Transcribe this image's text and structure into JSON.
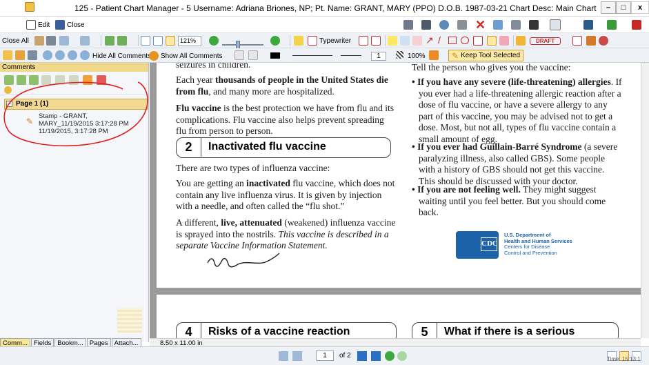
{
  "window": {
    "title": "125 - Patient Chart Manager - 5 Username: Adriana Briones, NP; Pt. Name: GRANT, MARY (PPO) D.O.B. 1987-03-21 Chart Desc: Main Chart",
    "minimize_label": "–",
    "restore_label": "□",
    "close_label": "x"
  },
  "toolbar1": {
    "edit_label": "Edit",
    "close_label": "Close"
  },
  "toolbar2": {
    "close_all_label": "Close All",
    "zoom_value": "121%",
    "typewriter_label": "Typewriter",
    "draft_stamp": "DRAFT"
  },
  "toolbar3": {
    "hide_all_label": "Hide All Comments",
    "show_all_label": "Show All Comments",
    "line_width": "1",
    "opacity": "100%",
    "keep_tool_label": "Keep Tool Selected"
  },
  "comments_panel": {
    "header": "Comments",
    "group_label": "Page 1 (1)",
    "expand_symbol": "−",
    "entry_lines": [
      "Stamp - GRANT,",
      "MARY_11/19/2015 3:17:28 PM",
      "11/19/2015, 3:17:28 PM"
    ]
  },
  "panel_tabs": [
    "Comm...",
    "Fields",
    "Bookm...",
    "Pages",
    "Attach..."
  ],
  "page_size": "8.50 x 11.00 in",
  "document": {
    "left": {
      "p0": "seizures in children.",
      "p1_a": "Each year ",
      "p1_b": "thousands of people in the United States die from flu",
      "p1_c": ", and many more are hospitalized.",
      "p2_a": "Flu vaccine",
      "p2_b": " is the best protection we have from flu and its complications. Flu vaccine also helps prevent spreading flu from person to person.",
      "section_num": "2",
      "section_title": "Inactivated flu vaccine",
      "p3": "There are two types of influenza vaccine:",
      "p4_a": "You are getting an ",
      "p4_b": "inactivated",
      "p4_c": " flu vaccine, which does not contain any live influenza virus. It is given by injection with a needle, and often called the “flu shot.”",
      "p5_a": "A different, ",
      "p5_b": "live, attenuated",
      "p5_c": " (weakened) influenza vaccine is sprayed into the nostrils. ",
      "p5_d": "This vaccine is described in a separate Vaccine Information Statement."
    },
    "right": {
      "p0": "Tell the person who gives you the vaccine:",
      "b1_a": "• If you have any severe (life-threatening) allergies",
      "b1_b": ". If you ever had a life-threatening allergic reaction after a dose of flu vaccine, or have a severe allergy to any part of this vaccine, you may be advised not to get a dose. Most, but not all, types of flu vaccine contain a small amount of egg.",
      "b2_a": "• If you ever had Guillain-Barré Syndrome",
      "b2_b": " (a severe paralyzing illness, also called GBS). Some people with a history of GBS should not get this vaccine. This should be discussed with your doctor.",
      "b3_a": "• If you are not feeling well.",
      "b3_b": " They might suggest waiting until you feel better. But you should come back.",
      "cdc_badge": "CDC",
      "hhs_lines": [
        "U.S. Department of",
        "Health and Human Services",
        "Centers for Disease",
        "Control and Prevention"
      ]
    },
    "page2": {
      "section4_num": "4",
      "section4_title": "Risks of a vaccine reaction",
      "section5_num": "5",
      "section5_title": "What if there is a serious"
    }
  },
  "statusbar": {
    "current_page": "1",
    "page_of": "of 2",
    "time_text": "Time: 15:13:1"
  },
  "colors": {
    "panel_header": "#f0d98a",
    "page_group": "#f3d990",
    "red_ink": "#e0201c",
    "cdc_blue": "#1c62a8"
  }
}
